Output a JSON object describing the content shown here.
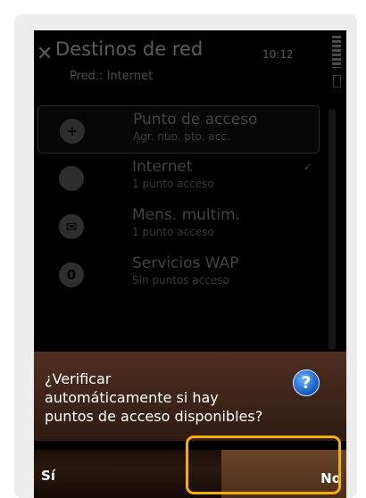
{
  "header": {
    "title": "Destinos de red",
    "subtitle": "Pred.: Internet",
    "clock": "10:12"
  },
  "list": {
    "items": [
      {
        "title": "Punto de acceso",
        "subtitle": "Agr. nuo. pto. acc.",
        "icon": "plus-globe-icon",
        "selected": true
      },
      {
        "title": "Internet",
        "subtitle": "1 punto acceso",
        "icon": "globe-icon",
        "default": true
      },
      {
        "title": "Mens. multim.",
        "subtitle": "1 punto acceso",
        "icon": "mms-icon"
      },
      {
        "title": "Servicios WAP",
        "subtitle": "Sin puntos acceso",
        "icon": "wap-icon",
        "icon_text": "0"
      }
    ]
  },
  "dialog": {
    "lines": [
      "¿Verificar",
      "automáticamente si hay",
      "puntos de acceso disponibles?"
    ],
    "help_icon": "?"
  },
  "softkeys": {
    "left": "Sí",
    "right": "No"
  },
  "colors": {
    "highlight": "#f3b000",
    "dialog_bg": "#4e2f21",
    "help_blue": "#1a63c9"
  }
}
